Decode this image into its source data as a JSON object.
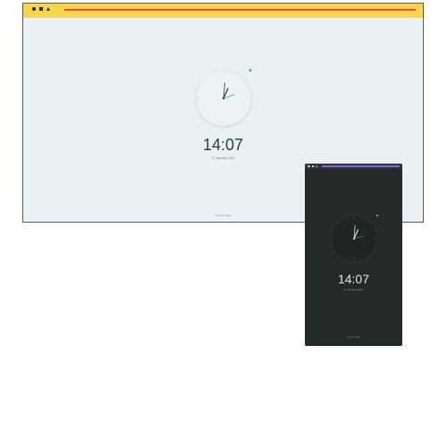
{
  "clock": {
    "time": "14:07",
    "date": "17 January 2024",
    "footer": "scroll to wake"
  },
  "desktop": {
    "window_icons": [
      "circle-icon",
      "square-icon",
      "triangle-icon"
    ],
    "colors": {
      "titlebar": "#f6d54b",
      "titlebar_line": "#e94b4b",
      "background": "#e9f1f2",
      "accent": "#25a187"
    }
  },
  "mobile": {
    "window_icons": [
      "circle-icon",
      "square-icon",
      "triangle-icon"
    ],
    "colors": {
      "titlebar_line": "#8d5cf0",
      "background": "#232a28",
      "accent": "#35b69a"
    }
  }
}
